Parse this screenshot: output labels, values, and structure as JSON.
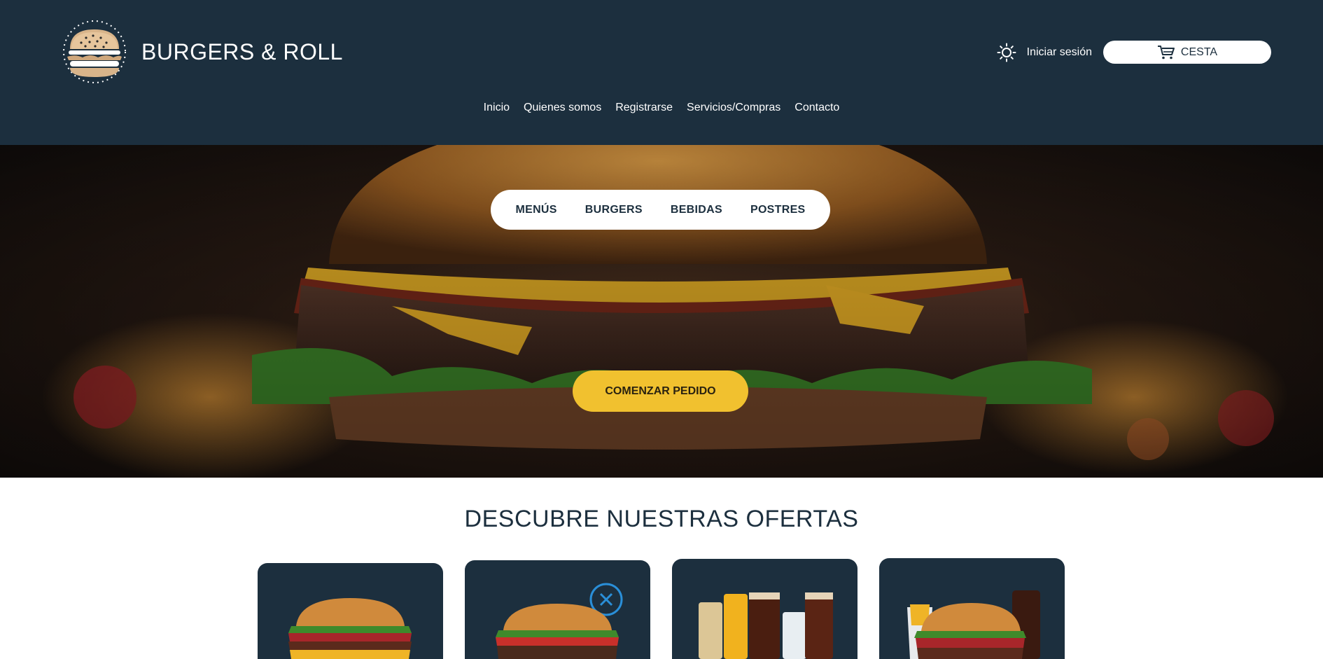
{
  "header": {
    "brand_title": "BURGERS & ROLL",
    "login_label": "Iniciar sesión",
    "cart_label": "CESTA",
    "nav": [
      "Inicio",
      "Quienes somos",
      "Registrarse",
      "Servicios/Compras",
      "Contacto"
    ]
  },
  "hero": {
    "categories": [
      "MENÚS",
      "BURGERS",
      "BEBIDAS",
      "POSTRES"
    ],
    "cta_label": "COMENZAR PEDIDO"
  },
  "offers": {
    "title": "DESCUBRE NUESTRAS OFERTAS",
    "cards": [
      {
        "image": "burger-bacon-image"
      },
      {
        "image": "burger-classic-image"
      },
      {
        "image": "drinks-image"
      },
      {
        "image": "combo-image"
      }
    ]
  },
  "colors": {
    "header_bg": "#1c2f3e",
    "accent_yellow": "#f1c12f",
    "text_dark": "#1c2f3e"
  },
  "icons": {
    "theme_toggle": "sun-icon",
    "cart": "cart-icon",
    "logo": "burger-logo-icon"
  }
}
